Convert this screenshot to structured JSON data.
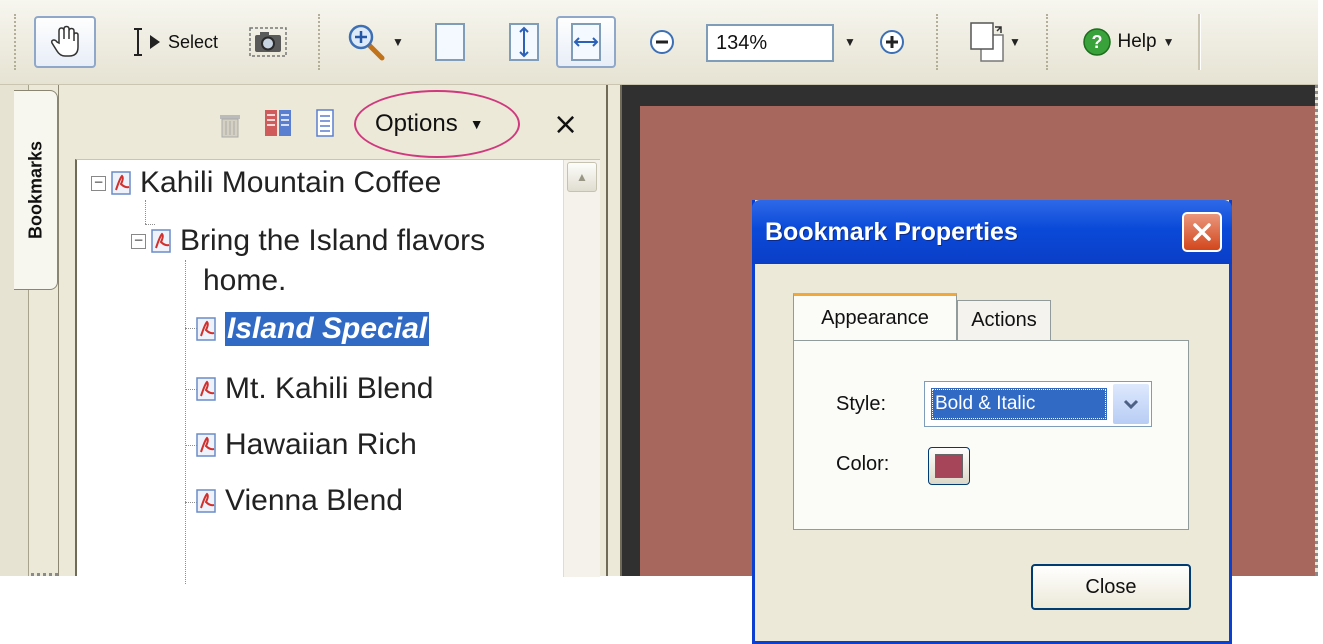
{
  "toolbar": {
    "select_label": "Select",
    "zoom_value": "134%",
    "help_label": "Help"
  },
  "bookmarks_tab": {
    "label": "Bookmarks"
  },
  "panel": {
    "options_label": "Options",
    "close_symbol": "×"
  },
  "tree": {
    "items": [
      {
        "label": "Kahili Mountain Coffee",
        "level": 0,
        "expanded": true
      },
      {
        "label": "Bring the Island flavors",
        "label_line2": "home.",
        "level": 1,
        "expanded": true
      },
      {
        "label": "Island Special",
        "level": 2,
        "selected": true
      },
      {
        "label": "Mt. Kahili Blend",
        "level": 2
      },
      {
        "label": "Hawaiian Rich",
        "level": 2
      },
      {
        "label": "Vienna Blend",
        "level": 2
      }
    ]
  },
  "dialog": {
    "title": "Bookmark Properties",
    "tabs": [
      "Appearance",
      "Actions"
    ],
    "active_tab": "Appearance",
    "style_label": "Style:",
    "style_value": "Bold & Italic",
    "color_label": "Color:",
    "color_value": "#a64559",
    "close_button": "Close"
  },
  "colors": {
    "page_background": "#a8675c",
    "selection": "#316ac5",
    "title_bar": "#0a4ad8",
    "highlight_oval": "#d0397e"
  }
}
